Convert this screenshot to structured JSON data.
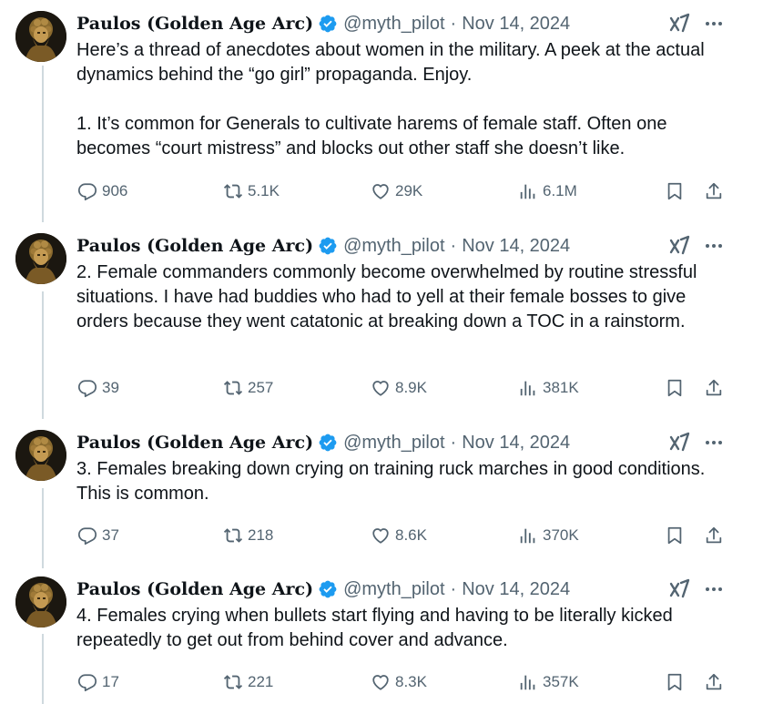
{
  "author": {
    "name": "Paulos (Golden Age Arc)",
    "handle": "@myth_pilot",
    "separator": "·",
    "date": "Nov 14, 2024"
  },
  "colors": {
    "text": "#0f1419",
    "muted": "#536471",
    "verified": "#1d9bf0",
    "thread_line": "#cfd9de"
  },
  "tweets": [
    {
      "paragraphs": [
        "Here’s a thread of anecdotes about women in the military. A peek at the actual dynamics behind the “go girl” propaganda. Enjoy.",
        "1. It’s common for Generals to cultivate harems of female staff. Often one becomes “court mistress” and blocks out other staff she doesn’t like."
      ],
      "replies": "906",
      "reposts": "5.1K",
      "likes": "29K",
      "views": "6.1M"
    },
    {
      "paragraphs": [
        "2. Female commanders commonly become overwhelmed by routine stressful situations. I have had buddies who had to yell at their female bosses to give orders because they went catatonic at breaking down a TOC in a rainstorm."
      ],
      "replies": "39",
      "reposts": "257",
      "likes": "8.9K",
      "views": "381K"
    },
    {
      "paragraphs": [
        "3. Females breaking down crying on training ruck marches in good conditions. This is common."
      ],
      "replies": "37",
      "reposts": "218",
      "likes": "8.6K",
      "views": "370K"
    },
    {
      "paragraphs": [
        "4. Females crying when bullets start flying and having to be literally kicked repeatedly to get out from behind cover and advance."
      ],
      "replies": "17",
      "reposts": "221",
      "likes": "8.3K",
      "views": "357K"
    }
  ],
  "icons": {
    "reply": "reply-icon",
    "repost": "repost-icon",
    "like": "like-icon",
    "views": "views-icon",
    "bookmark": "bookmark-icon",
    "share": "share-icon",
    "verified": "verified-badge-icon",
    "grok": "grok-icon",
    "more": "more-icon"
  }
}
